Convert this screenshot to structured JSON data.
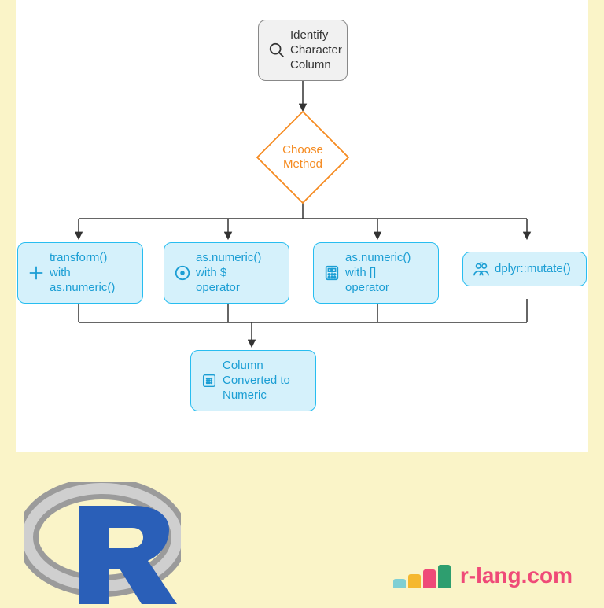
{
  "diagram": {
    "start": {
      "label": "Identify\nCharacter\nColumn"
    },
    "decision": {
      "label": "Choose\nMethod"
    },
    "methods": [
      {
        "label": "transform()\nwith\nas.numeric()"
      },
      {
        "label": "as.numeric()\nwith $\noperator"
      },
      {
        "label": "as.numeric()\nwith []\noperator"
      },
      {
        "label": "dplyr::mutate()"
      }
    ],
    "result": {
      "label": "Column\nConverted to\nNumeric"
    }
  },
  "brand": {
    "text": "r-lang.com",
    "bars": [
      {
        "color": "#7ecfd4",
        "height": 12
      },
      {
        "color": "#f5b82e",
        "height": 18
      },
      {
        "color": "#ef4a78",
        "height": 24
      },
      {
        "color": "#2e9e6f",
        "height": 30
      }
    ]
  }
}
